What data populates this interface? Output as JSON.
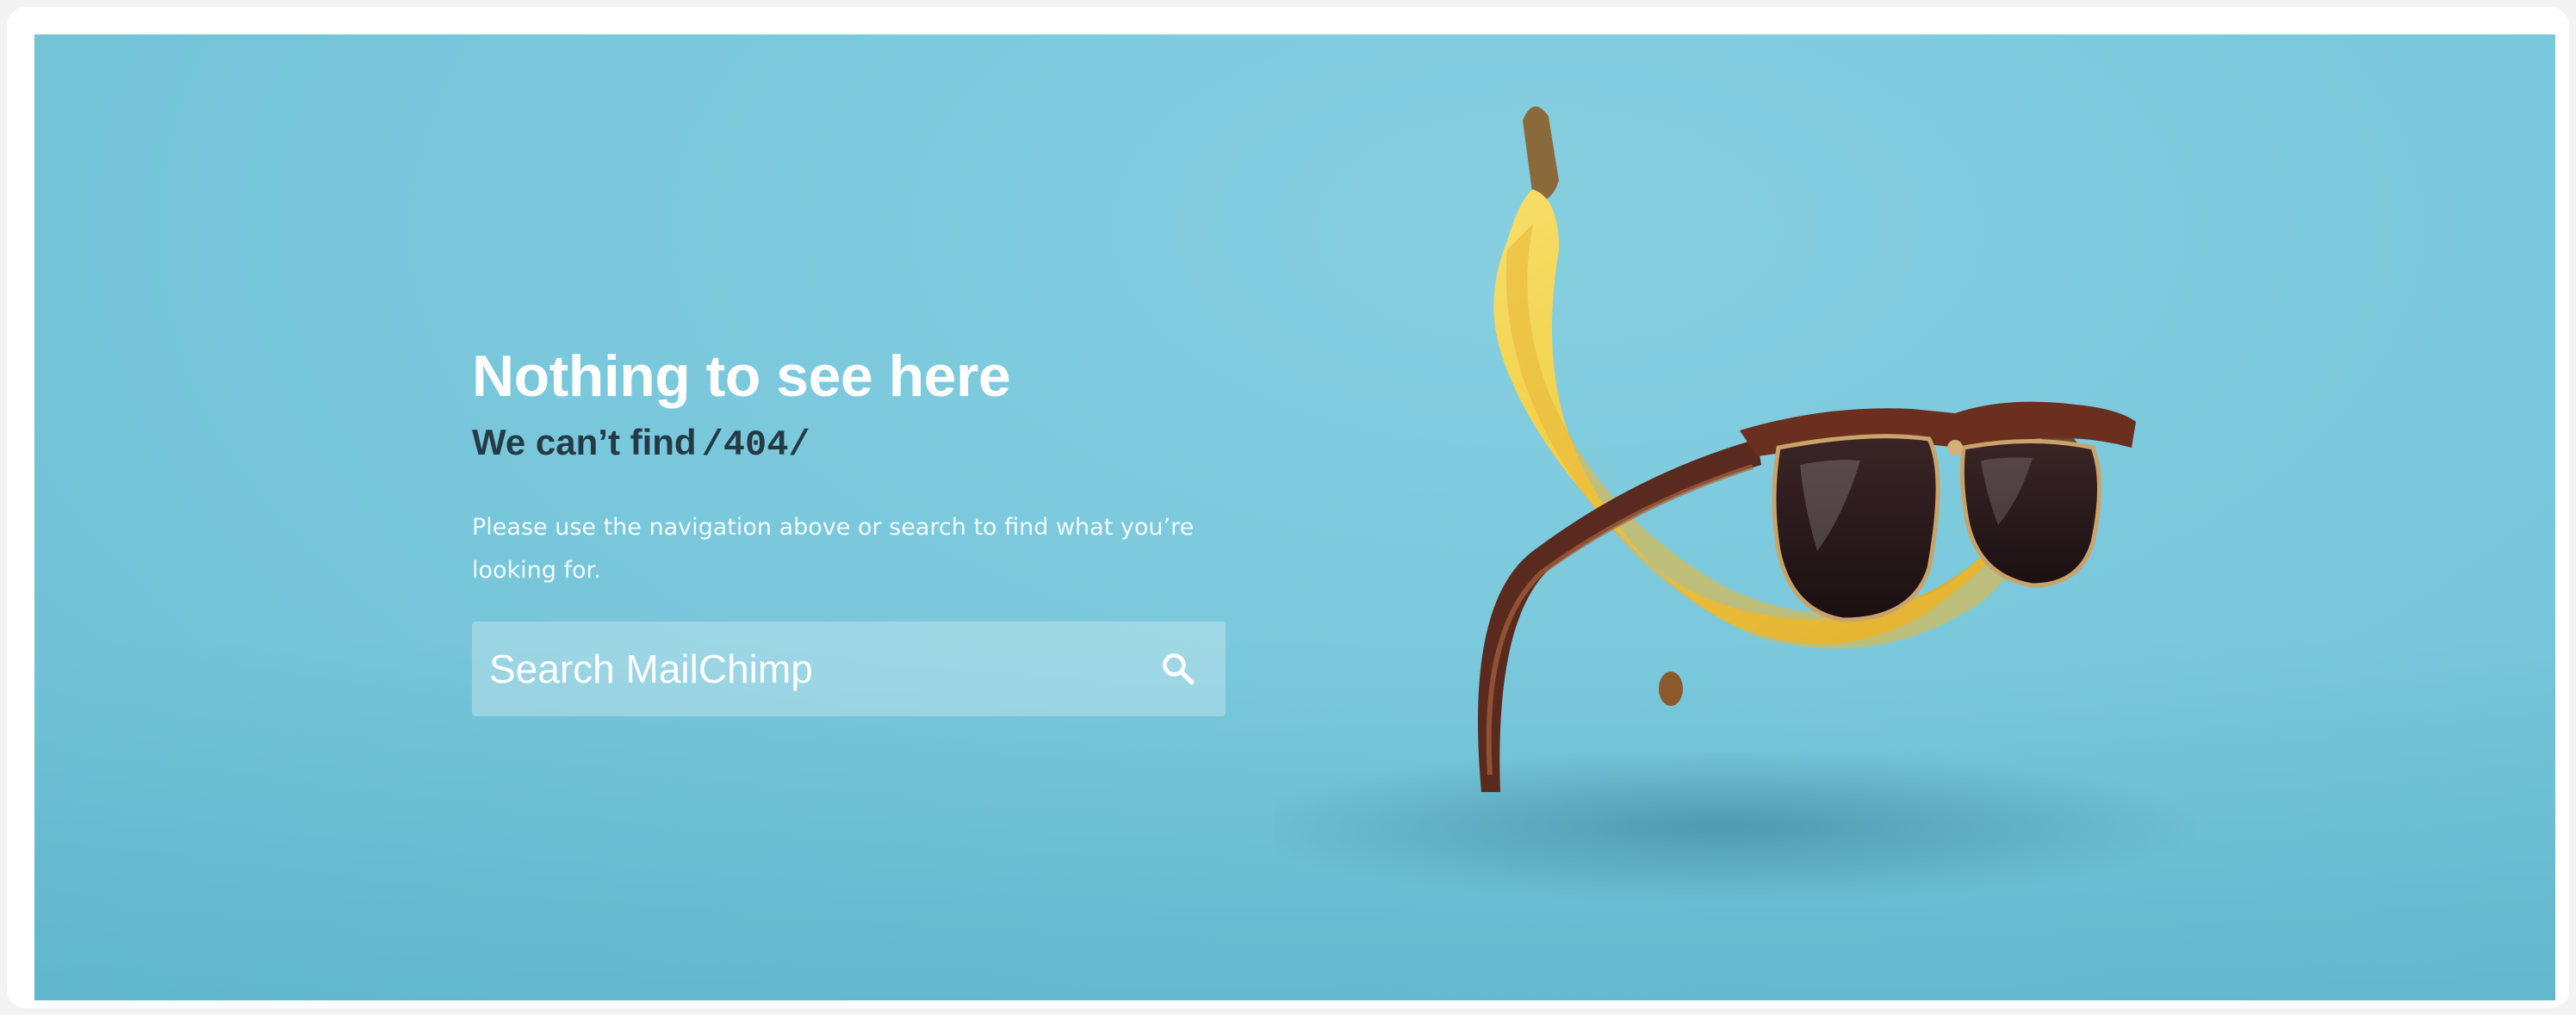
{
  "hero": {
    "title": "Nothing to see here",
    "subtitle": "We can’t find",
    "code": "/404/",
    "description": "Please use the navigation above or search to find what you’re looking for."
  },
  "search": {
    "placeholder": "Search MailChimp",
    "icon": "search-icon"
  },
  "illustration": {
    "subject": "banana-with-sunglasses-icon"
  },
  "colors": {
    "background": "#7ac8dc",
    "title": "#ffffff",
    "subtitle": "#243b46",
    "banana": "#f2cf3f"
  }
}
